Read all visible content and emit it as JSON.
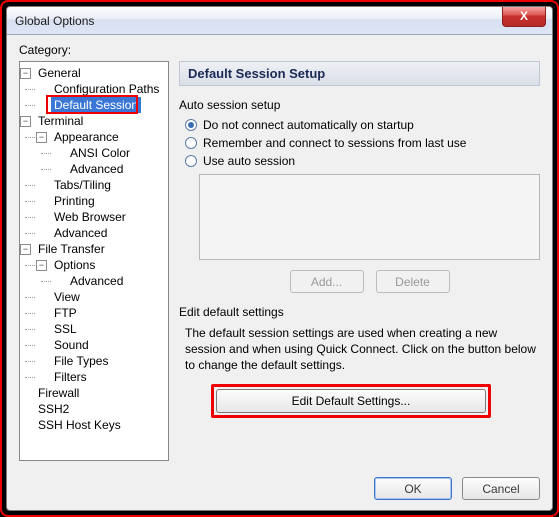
{
  "window": {
    "title": "Global Options",
    "close": "X"
  },
  "category_label": "Category:",
  "tree": {
    "general": "General",
    "config_paths": "Configuration Paths",
    "default_session": "Default Session",
    "terminal": "Terminal",
    "appearance": "Appearance",
    "ansi_color": "ANSI Color",
    "advanced": "Advanced",
    "tabs_tiling": "Tabs/Tiling",
    "printing": "Printing",
    "web_browser": "Web Browser",
    "advanced2": "Advanced",
    "file_transfer": "File Transfer",
    "options": "Options",
    "advanced3": "Advanced",
    "view": "View",
    "ftp": "FTP",
    "ssl": "SSL",
    "sound": "Sound",
    "file_types": "File Types",
    "filters": "Filters",
    "firewall": "Firewall",
    "ssh2": "SSH2",
    "ssh_host_keys": "SSH Host Keys"
  },
  "panel": {
    "header": "Default Session Setup",
    "auto_title": "Auto session setup",
    "radio1": "Do not connect automatically on startup",
    "radio2": "Remember and connect to sessions from last use",
    "radio3": "Use auto session",
    "add_btn": "Add...",
    "delete_btn": "Delete",
    "edit_title": "Edit default settings",
    "edit_desc": "The default session settings are used when creating a new session and when using Quick Connect.  Click on the button below to change the default settings.",
    "edit_btn": "Edit Default Settings..."
  },
  "buttons": {
    "ok": "OK",
    "cancel": "Cancel"
  }
}
